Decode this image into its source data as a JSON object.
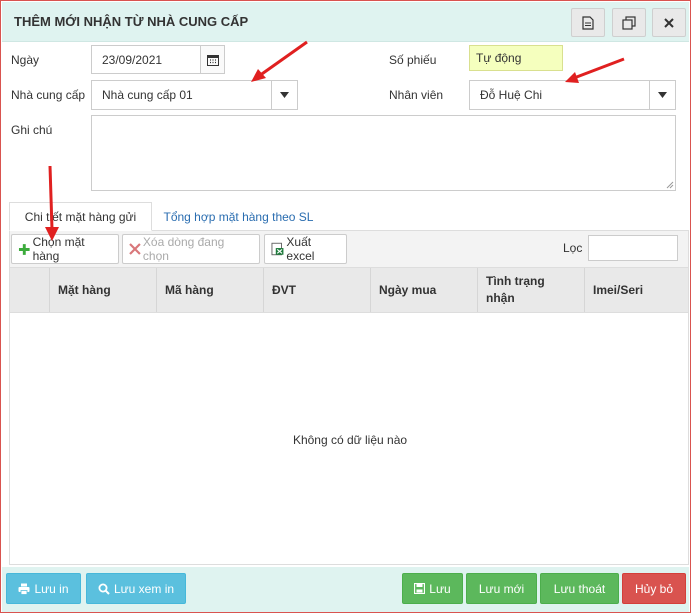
{
  "dialog": {
    "title": "THÊM MỚI NHẬN TỪ NHÀ CUNG CẤP"
  },
  "form": {
    "date_label": "Ngày",
    "date_value": "23/09/2021",
    "voucher_label": "Số phiếu",
    "voucher_value": "Tự động",
    "supplier_label": "Nhà cung cấp",
    "supplier_value": "Nhà cung cấp 01",
    "staff_label": "Nhân viên",
    "staff_value": "Đỗ Huệ Chi",
    "note_label": "Ghi chú",
    "note_value": ""
  },
  "tabs": [
    {
      "label": "Chi tiết mặt hàng gửi"
    },
    {
      "label": "Tổng hợp mặt hàng theo SL"
    }
  ],
  "toolbar": {
    "choose_item": "Chọn mặt hàng",
    "delete_selected": "Xóa dòng đang chọn",
    "export_excel": "Xuất excel",
    "filter_label": "Lọc",
    "filter_value": ""
  },
  "grid": {
    "columns": [
      "Mặt hàng",
      "Mã hàng",
      "ĐVT",
      "Ngày mua",
      "Tình trạng nhận",
      "Imei/Seri"
    ],
    "empty_text": "Không có dữ liệu nào"
  },
  "footer": {
    "save_print": "Lưu in",
    "save_preview": "Lưu xem in",
    "save": "Lưu",
    "save_new": "Lưu mới",
    "save_exit": "Lưu thoát",
    "cancel": "Hủy bỏ"
  },
  "colors": {
    "header_bg": "#dff3f0",
    "accent_red": "#d9534f",
    "info_blue": "#5bc0de",
    "success_green": "#5cb85c"
  }
}
